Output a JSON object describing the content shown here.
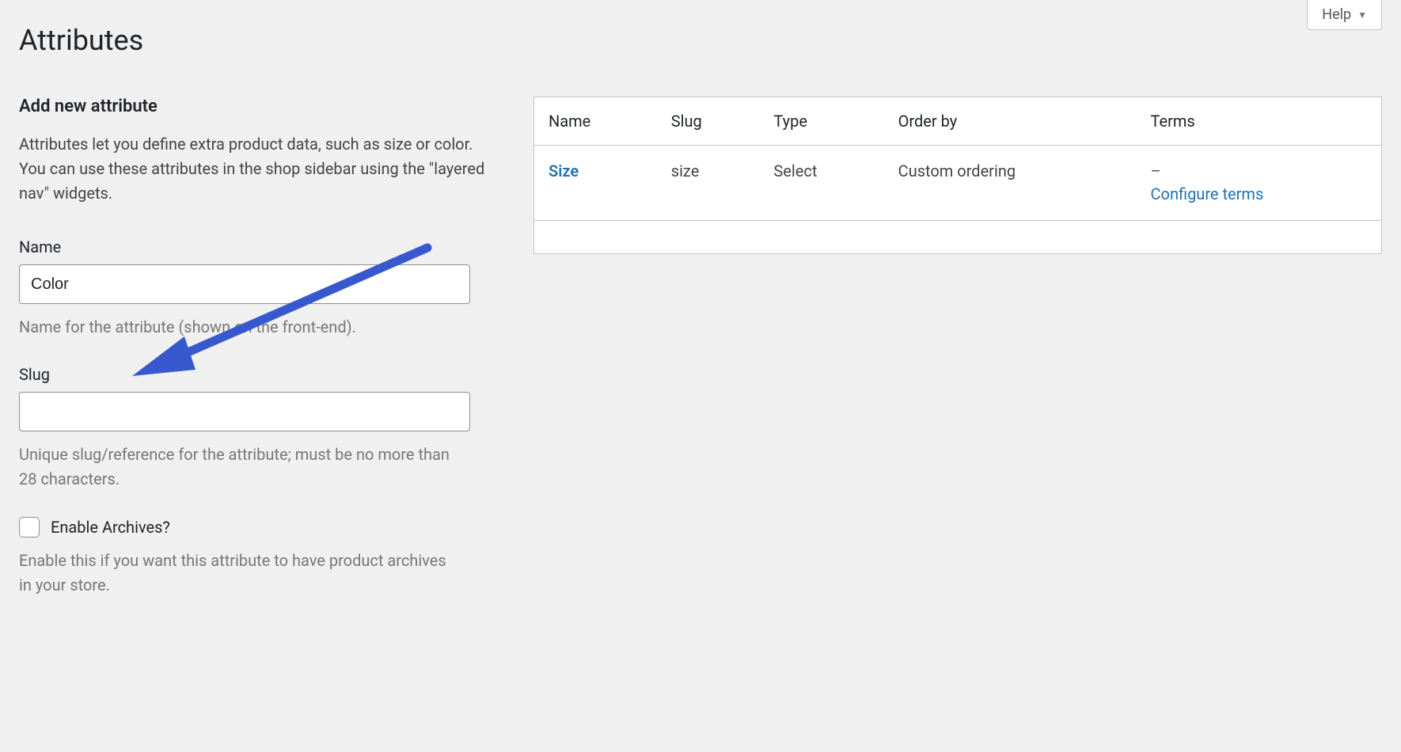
{
  "help_button": "Help",
  "page_title": "Attributes",
  "form": {
    "heading": "Add new attribute",
    "intro": "Attributes let you define extra product data, such as size or color. You can use these attributes in the shop sidebar using the \"layered nav\" widgets.",
    "name_label": "Name",
    "name_value": "Color",
    "name_help": "Name for the attribute (shown on the front-end).",
    "slug_label": "Slug",
    "slug_value": "",
    "slug_help": "Unique slug/reference for the attribute; must be no more than 28 characters.",
    "archives_label": "Enable Archives?",
    "archives_help": "Enable this if you want this attribute to have product archives in your store."
  },
  "table": {
    "headers": {
      "name": "Name",
      "slug": "Slug",
      "type": "Type",
      "order_by": "Order by",
      "terms": "Terms"
    },
    "rows": [
      {
        "name": "Size",
        "slug": "size",
        "type": "Select",
        "order_by": "Custom ordering",
        "terms_dash": "–",
        "configure": "Configure terms"
      }
    ]
  }
}
